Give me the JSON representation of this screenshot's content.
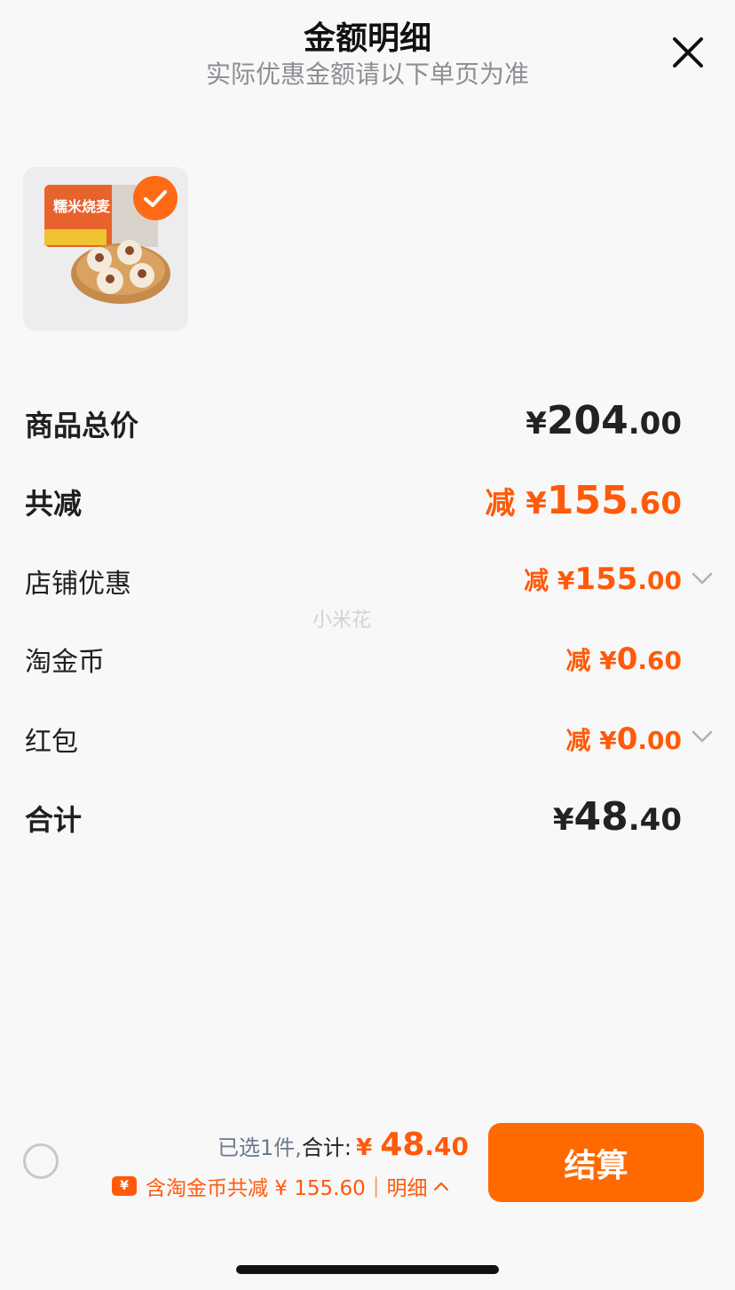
{
  "header": {
    "title": "金额明细",
    "subtitle": "实际优惠金额请以下单页为准"
  },
  "product": {
    "thumbnail_text": "糯米烧麦",
    "selected": true
  },
  "rows": {
    "goods_total": {
      "label": "商品总价",
      "symbol": "¥",
      "int": "204",
      "dec": ".00"
    },
    "total_reduce": {
      "label": "共减",
      "prefix": "减 ",
      "symbol": "¥",
      "int": "155",
      "dec": ".60"
    },
    "shop_discount": {
      "label": "店铺优惠",
      "prefix": "减 ",
      "symbol": "¥",
      "int": "155",
      "dec": ".00"
    },
    "taojinbi": {
      "label": "淘金币",
      "prefix": "减 ",
      "symbol": "¥",
      "int": "0",
      "dec": ".60"
    },
    "red_packet": {
      "label": "红包",
      "prefix": "减 ",
      "symbol": "¥",
      "int": "0",
      "dec": ".00"
    },
    "sum": {
      "label": "合计",
      "symbol": "¥",
      "int": "48",
      "dec": ".40"
    }
  },
  "watermark": "小米花",
  "footer": {
    "selected_text": "已选1件,",
    "total_label": "合计:",
    "total_symbol": "¥ ",
    "total_int": "48",
    "total_dec": ".40",
    "coin_icon": "¥",
    "coin_text": "含淘金币共减 ¥ 155.60",
    "separator": "|",
    "detail_label": "明细",
    "checkout_label": "结算"
  },
  "colors": {
    "accent": "#ff6a00",
    "reduce": "#ff5a0a",
    "background": "#f8f8f9"
  }
}
